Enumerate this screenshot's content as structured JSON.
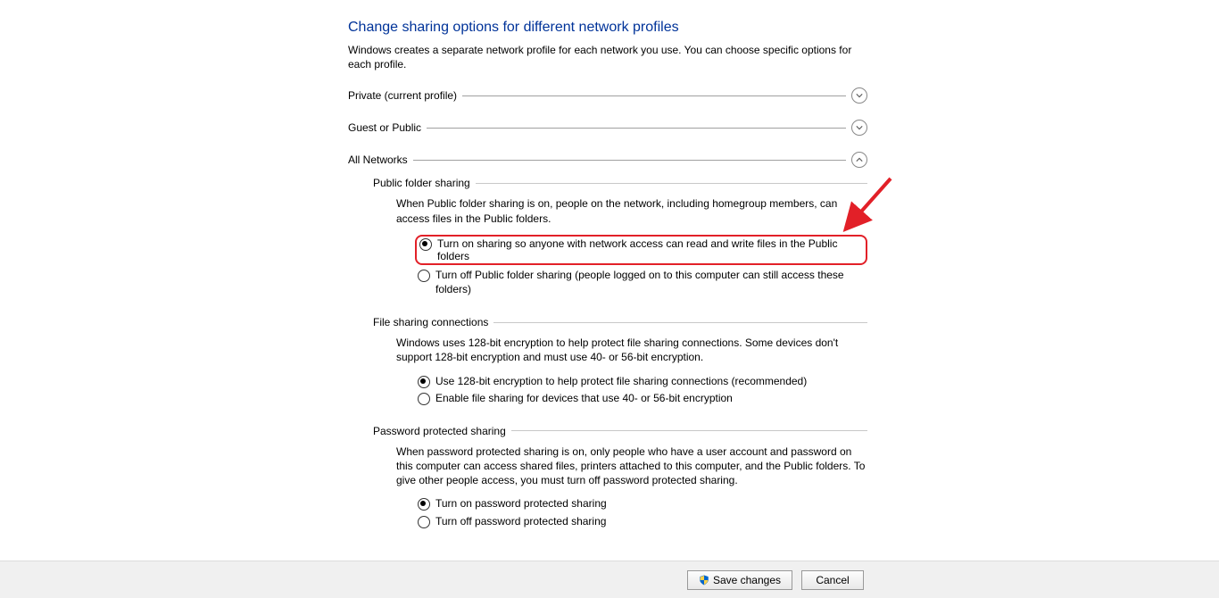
{
  "page": {
    "title": "Change sharing options for different network profiles",
    "description": "Windows creates a separate network profile for each network you use. You can choose specific options for each profile."
  },
  "sections": {
    "private": {
      "label": "Private (current profile)"
    },
    "guest": {
      "label": "Guest or Public"
    },
    "all": {
      "label": "All Networks"
    }
  },
  "publicFolder": {
    "header": "Public folder sharing",
    "description": "When Public folder sharing is on, people on the network, including homegroup members, can access files in the Public folders.",
    "option_on": "Turn on sharing so anyone with network access can read and write files in the Public folders",
    "option_off": "Turn off Public folder sharing (people logged on to this computer can still access these folders)"
  },
  "fileSharing": {
    "header": "File sharing connections",
    "description": "Windows uses 128-bit encryption to help protect file sharing connections. Some devices don't support 128-bit encryption and must use 40- or 56-bit encryption.",
    "option_128": "Use 128-bit encryption to help protect file sharing connections (recommended)",
    "option_40": "Enable file sharing for devices that use 40- or 56-bit encryption"
  },
  "password": {
    "header": "Password protected sharing",
    "description": "When password protected sharing is on, only people who have a user account and password on this computer can access shared files, printers attached to this computer, and the Public folders. To give other people access, you must turn off password protected sharing.",
    "option_on": "Turn on password protected sharing",
    "option_off": "Turn off password protected sharing"
  },
  "buttons": {
    "save": "Save changes",
    "cancel": "Cancel"
  }
}
